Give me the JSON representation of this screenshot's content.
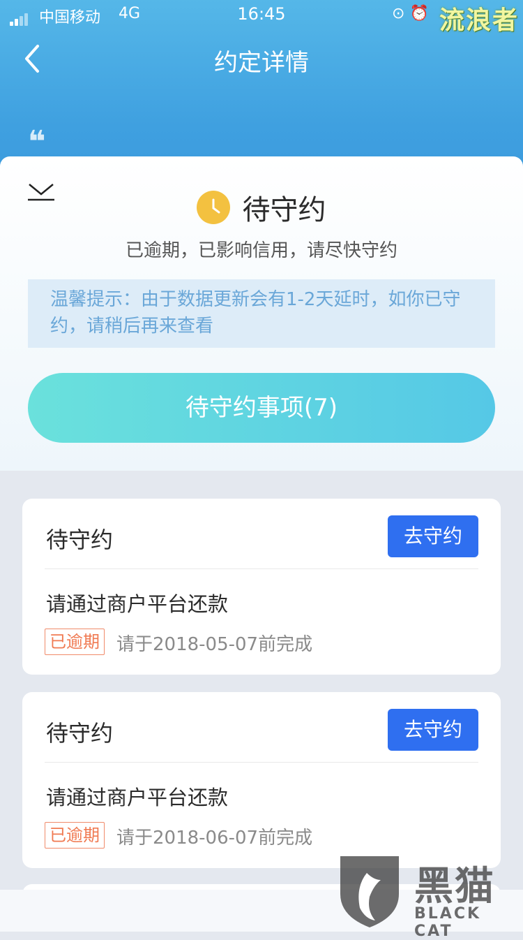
{
  "status_bar": {
    "carrier": "中国移动",
    "network": "4G",
    "time": "16:45",
    "icons": [
      "rotation-lock-icon",
      "alarm-icon"
    ],
    "watermark": "流浪者"
  },
  "nav": {
    "title": "约定详情",
    "back_icon": "chevron-left-icon"
  },
  "panel": {
    "status_title": "待守约",
    "status_subtitle": "已逾期，已影响信用，请尽快守约",
    "tip": "温馨提示：由于数据更新会有1-2天延时，如你已守约，请稍后再来查看",
    "main_button": "待守约事项(7)"
  },
  "cards": [
    {
      "title": "待守约",
      "button": "去守约",
      "description": "请通过商户平台还款",
      "badge": "已逾期",
      "due": "请于2018-05-07前完成"
    },
    {
      "title": "待守约",
      "button": "去守约",
      "description": "请通过商户平台还款",
      "badge": "已逾期",
      "due": "请于2018-06-07前完成"
    }
  ],
  "watermark": {
    "text": "黑猫",
    "sub": "BLACK CAT"
  },
  "colors": {
    "header_blue": "#3fa0e0",
    "primary_button": "#2f6ff0",
    "overdue_red": "#f07a52",
    "status_yellow": "#f3c140"
  }
}
